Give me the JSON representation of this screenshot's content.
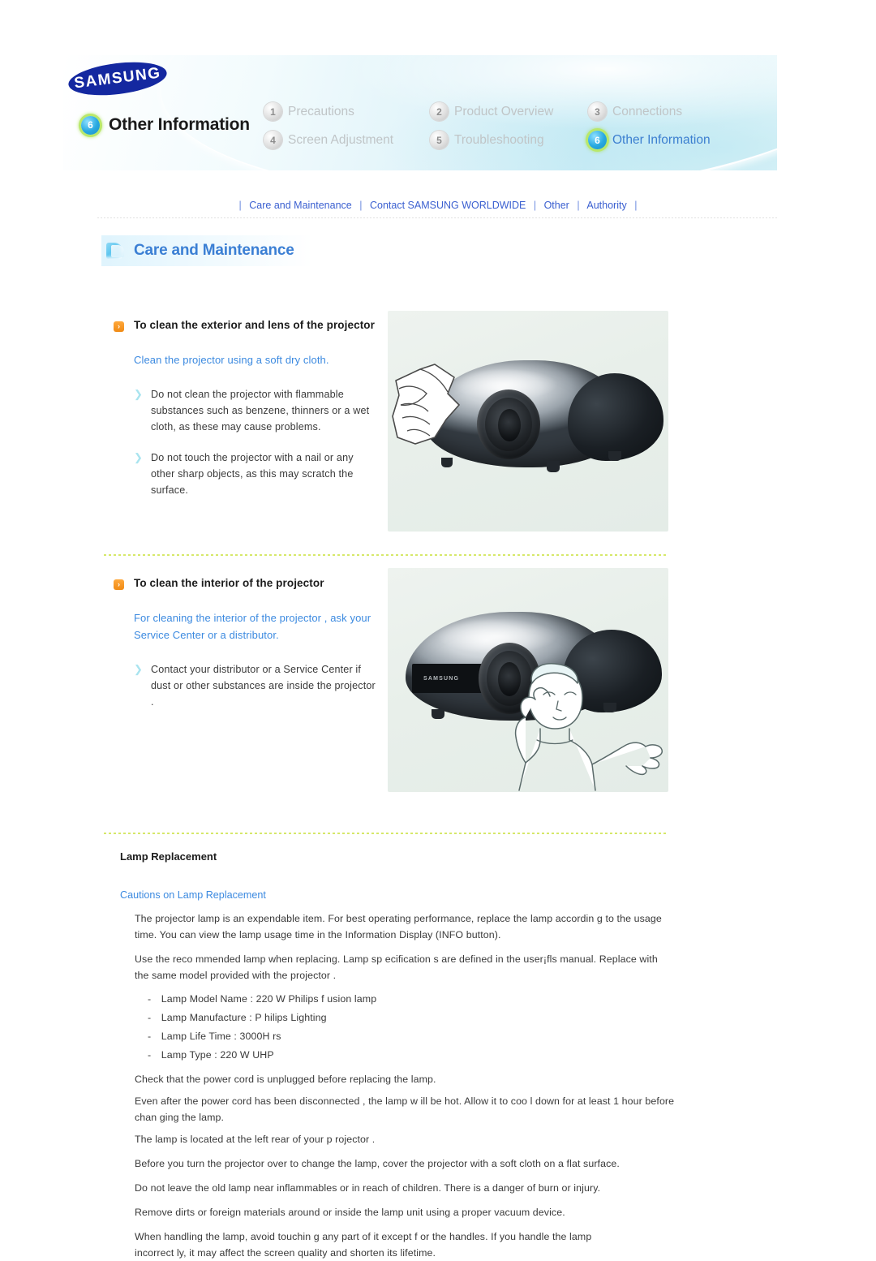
{
  "header": {
    "logo_text": "SAMSUNG",
    "current_section_number": "6",
    "current_section_title": "Other Information",
    "nav_items": [
      {
        "number": "1",
        "label": "Precautions",
        "active": false
      },
      {
        "number": "2",
        "label": "Product Overview",
        "active": false
      },
      {
        "number": "3",
        "label": "Connections",
        "active": false
      },
      {
        "number": "4",
        "label": "Screen Adjustment",
        "active": false
      },
      {
        "number": "5",
        "label": "Troubleshooting",
        "active": false
      },
      {
        "number": "6",
        "label": "Other Information",
        "active": true
      }
    ]
  },
  "subnav": {
    "sep": "|",
    "items": [
      {
        "label": "Care and Maintenance"
      },
      {
        "label": "Contact SAMSUNG WORLDWIDE"
      },
      {
        "label": "Other"
      },
      {
        "label": "Authority"
      }
    ]
  },
  "banner": {
    "icon": "page-stack-icon",
    "title": "Care and Maintenance"
  },
  "section1": {
    "bullet_glyph": "›",
    "heading": "To clean the exterior and lens of the projector",
    "lead": "Clean the projector using a soft dry cloth.",
    "tick_glyph": "❯",
    "items": [
      "Do not clean the projector with flammable substances such as benzene, thinners or a wet cloth, as these may cause problems.",
      "Do not touch the projector with a nail or any other sharp objects, as this may scratch the surface."
    ],
    "image_alt": "projector-being-wiped-with-cloth"
  },
  "section2": {
    "bullet_glyph": "›",
    "heading": "To clean the interior of the projector",
    "lead": "For cleaning the interior of the projector , ask your Service Center or a distributor.",
    "tick_glyph": "❯",
    "items": [
      "Contact your distributor or a Service Center if dust or other substances are inside the projector ."
    ],
    "image_alt": "person-calling-service-center-next-to-projector",
    "projector_brand": "SAMSUNG"
  },
  "lamp": {
    "heading": "Lamp Replacement",
    "subheading": "Cautions on Lamp Replacement",
    "paragraphs_top": [
      "The projector lamp is an expendable item. For best operating performance, replace the lamp accordin g to the usage time. You can view the lamp usage time in the Information Display (INFO button).",
      "Use the reco mmended lamp when replacing. Lamp sp ecification s are defined in the user¡fls manual. Replace with the same model provided with the projector ."
    ],
    "specs": [
      {
        "dash": "-",
        "text": "Lamp Model Name : 220 W Philips f usion lamp"
      },
      {
        "dash": "-",
        "text": "Lamp Manufacture : P hilips Lighting"
      },
      {
        "dash": "-",
        "text": "Lamp Life Time : 3000H rs"
      },
      {
        "dash": "-",
        "text": "Lamp Type : 220 W UHP"
      }
    ],
    "paragraphs_bottom": [
      "Check that the power cord is unplugged before replacing the lamp.",
      "Even after the power cord has been disconnected , the lamp w ill be hot. Allow it to coo l down for at least 1 hour before chan ging the lamp.",
      "The lamp is located at the left rear of your p rojector .",
      "Before you turn the projector over to change the lamp, cover the projector with a soft cloth on a flat surface.",
      "Do not leave the old lamp near inflammables or in reach of children. There is a danger of burn or injury.",
      "Remove dirts or foreign materials around or inside the lamp unit using a proper vacuum device.",
      "When handling the lamp, avoid touchin g any part of it except f or the handles. If you handle the lamp incorrect ly, it may affect the screen quality and shorten its lifetime."
    ]
  },
  "colors": {
    "brand_blue": "#1428a0",
    "link_blue": "#3a5fd0",
    "heading_blue": "#3b7fd4",
    "accent_orange": "#f08a14",
    "tick_teal": "#a9e4ef",
    "divider_green": "#d6e86a"
  }
}
